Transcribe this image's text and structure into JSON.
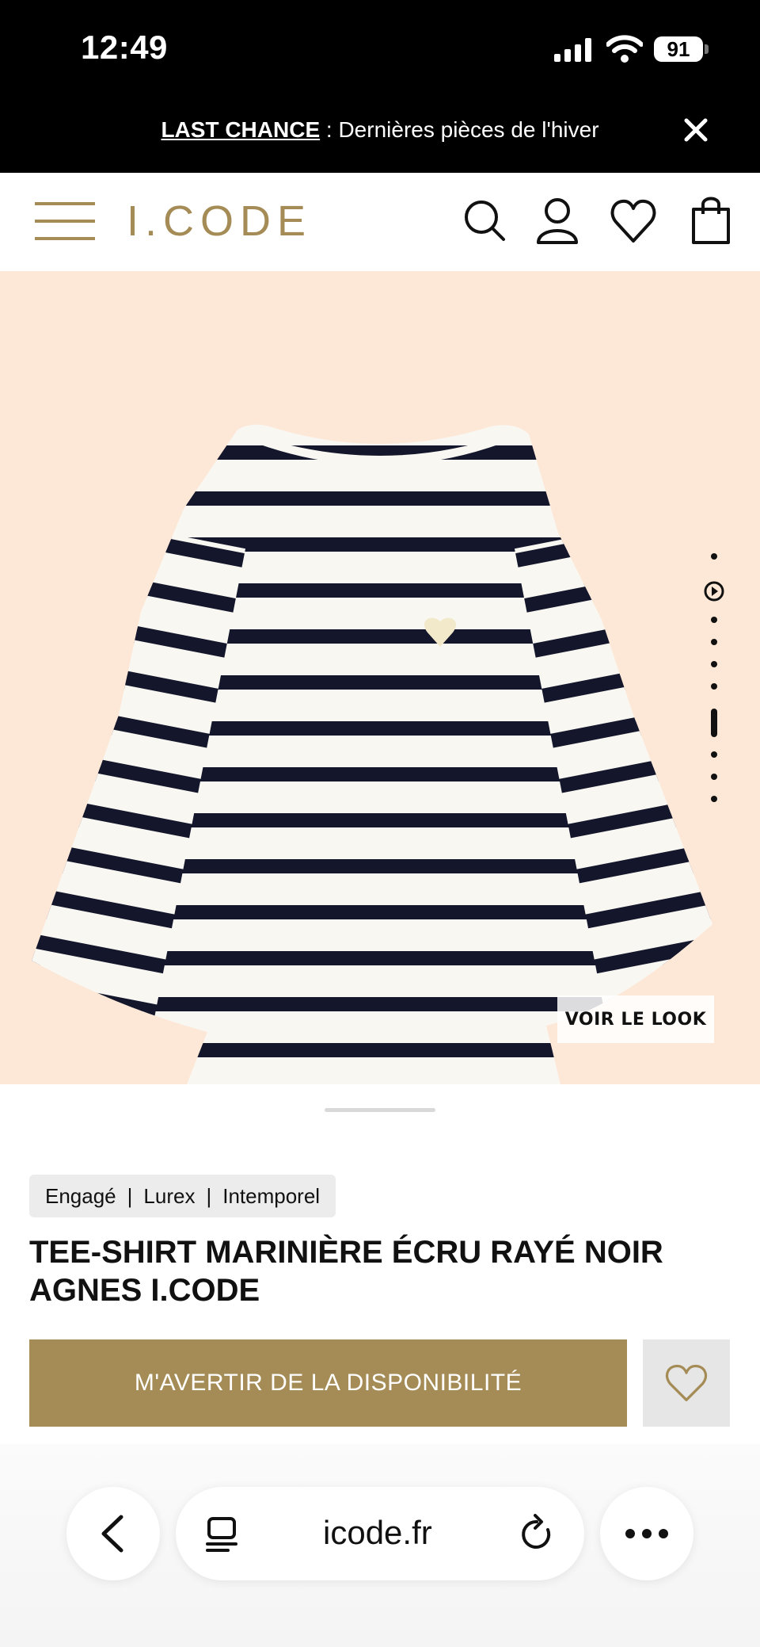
{
  "status_bar": {
    "time": "12:49",
    "battery": "91"
  },
  "promo": {
    "bold": "LAST CHANCE",
    "text": " : Dernières pièces de l'hiver"
  },
  "header": {
    "logo": "I.CODE"
  },
  "hero": {
    "voir_le_look": "VOIR LE LOOK"
  },
  "product": {
    "tags": [
      "Engagé",
      "Lurex",
      "Intemporel"
    ],
    "title": "TEE-SHIRT MARINIÈRE ÉCRU RAYÉ NOIR AGNES I.CODE",
    "notify_label": "M'AVERTIR DE LA DISPONIBILITÉ"
  },
  "browser": {
    "url": "icode.fr"
  },
  "colors": {
    "brand_gold": "#a58c56",
    "hero_bg": "#fde8d8",
    "stripe": "#14172b"
  },
  "icons": [
    "menu-icon",
    "search-icon",
    "account-icon",
    "heart-icon",
    "bag-icon",
    "close-icon",
    "play-icon",
    "back-icon",
    "tabs-icon",
    "reload-icon",
    "more-icon"
  ]
}
